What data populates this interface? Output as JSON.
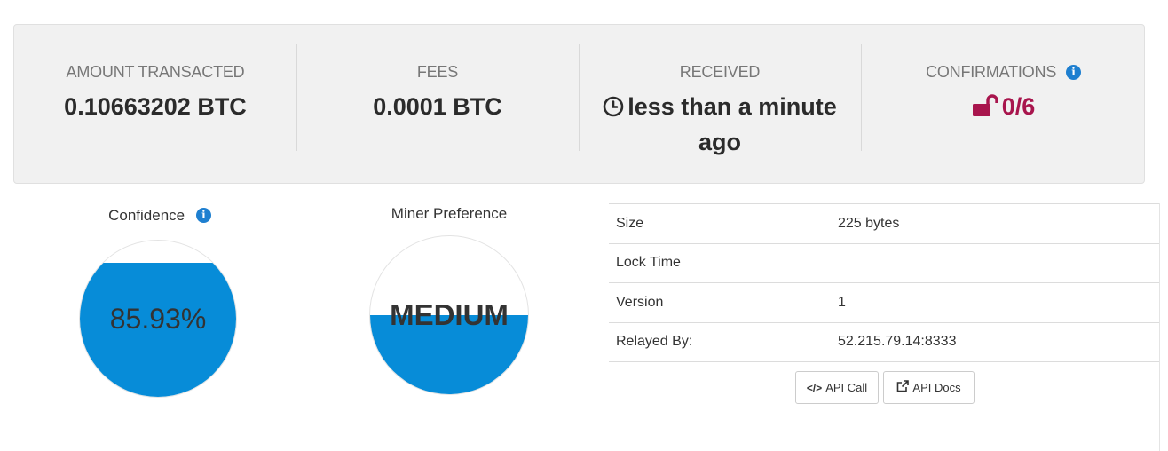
{
  "stats": {
    "amount_label": "AMOUNT TRANSACTED",
    "amount_value": "0.10663202 BTC",
    "fees_label": "FEES",
    "fees_value": "0.0001 BTC",
    "received_label": "RECEIVED",
    "received_line1": "less than a minute",
    "received_line2": "ago",
    "confirmations_label": "CONFIRMATIONS",
    "confirmations_value": "0/6"
  },
  "gauges": {
    "confidence_title": "Confidence",
    "confidence_value": "85.93%",
    "confidence_fill_fraction": 0.8593,
    "miner_title": "Miner Preference",
    "miner_value": "MEDIUM",
    "miner_fill_fraction": 0.5
  },
  "details": [
    {
      "key": "Size",
      "value": "225 bytes"
    },
    {
      "key": "Lock Time",
      "value": ""
    },
    {
      "key": "Version",
      "value": "1"
    },
    {
      "key": "Relayed By:",
      "value": "52.215.79.14:8333"
    }
  ],
  "buttons": {
    "api_call": "API Call",
    "api_docs": "API Docs"
  },
  "colors": {
    "accent_blue": "#078cd8",
    "info_blue": "#1e7fd0",
    "confirmations_red": "#a8154d"
  }
}
